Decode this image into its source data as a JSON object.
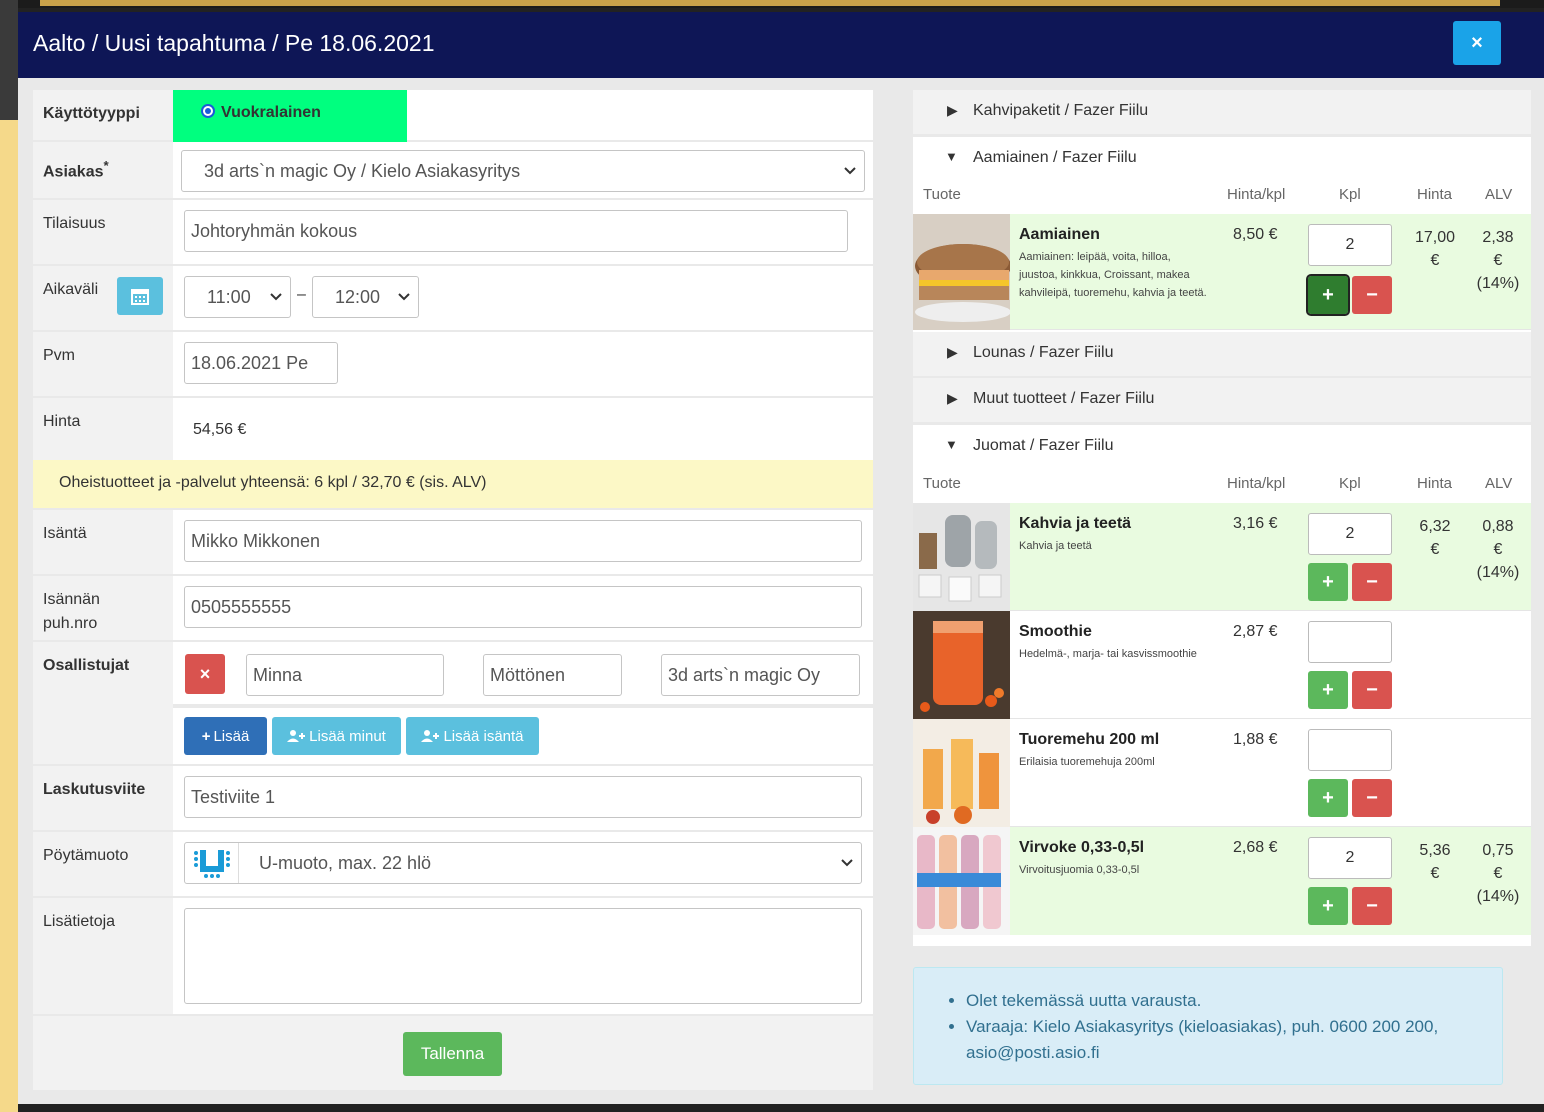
{
  "header": {
    "title": "Aalto / Uusi tapahtuma / Pe 18.06.2021",
    "close_label": "×"
  },
  "form": {
    "usage_type": {
      "label": "Käyttötyyppi",
      "option": "Vuokralainen"
    },
    "customer": {
      "label": "Asiakas",
      "required_mark": "*",
      "value": "3d arts`n magic Oy / Kielo Asiakasyritys"
    },
    "occasion": {
      "label": "Tilaisuus",
      "value": "Johtoryhmän kokous"
    },
    "time_range": {
      "label": "Aikaväli",
      "start": "11:00",
      "separator": "–",
      "end": "12:00"
    },
    "date": {
      "label": "Pvm",
      "value": "18.06.2021 Pe"
    },
    "price": {
      "label": "Hinta",
      "value": "54,56 €"
    },
    "extras_summary": "Oheistuotteet ja -palvelut yhteensä: 6 kpl / 32,70 € (sis. ALV)",
    "host": {
      "label": "Isäntä",
      "value": "Mikko Mikkonen"
    },
    "host_phone": {
      "label_line1": "Isännän",
      "label_line2": "puh.nro",
      "value": "0505555555"
    },
    "participants": {
      "label": "Osallistujat",
      "remove_label": "×",
      "first_name": "Minna",
      "last_name": "Möttönen",
      "company": "3d arts`n magic Oy",
      "add_label": "Lisää",
      "add_me_label": "Lisää minut",
      "add_host_label": "Lisää isäntä"
    },
    "billing_ref": {
      "label": "Laskutusviite",
      "value": "Testiviite 1"
    },
    "table_layout": {
      "label": "Pöytämuoto",
      "value": "U-muoto, max. 22 hlö"
    },
    "notes": {
      "label": "Lisätietoja",
      "value": ""
    },
    "save_label": "Tallenna"
  },
  "catalog": {
    "headers": {
      "product": "Tuote",
      "unit_price": "Hinta/kpl",
      "qty": "Kpl",
      "price": "Hinta",
      "vat": "ALV"
    },
    "categories": [
      {
        "label": "Kahvipaketit / Fazer Fiilu"
      },
      {
        "label": "Aamiainen / Fazer Fiilu"
      },
      {
        "label": "Lounas / Fazer Fiilu"
      },
      {
        "label": "Muut tuotteet / Fazer Fiilu"
      },
      {
        "label": "Juomat / Fazer Fiilu"
      }
    ],
    "breakfast": [
      {
        "name": "Aamiainen",
        "desc": "Aamiainen: leipää, voita, hilloa, juustoa, kinkkua, Croissant, makea kahvileipä, tuoremehu, kahvia ja teetä.",
        "unit_price": "8,50 €",
        "qty": "2",
        "total_1": "17,00",
        "total_2": "€",
        "vat_1": "2,38",
        "vat_2": "€",
        "vat_3": "(14%)"
      }
    ],
    "drinks": [
      {
        "name": "Kahvia ja teetä",
        "desc": "Kahvia ja teetä",
        "unit_price": "3,16 €",
        "qty": "2",
        "total_1": "6,32",
        "total_2": "€",
        "vat_1": "0,88",
        "vat_2": "€",
        "vat_3": "(14%)"
      },
      {
        "name": "Smoothie",
        "desc": "Hedelmä-, marja- tai kasvissmoothie",
        "unit_price": "2,87 €",
        "qty": ""
      },
      {
        "name": "Tuoremehu 200 ml",
        "desc": "Erilaisia tuoremehuja 200ml",
        "unit_price": "1,88 €",
        "qty": ""
      },
      {
        "name": "Virvoke 0,33-0,5l",
        "desc": "Virvoitusjuomia 0,33-0,5l",
        "unit_price": "2,68 €",
        "qty": "2",
        "total_1": "5,36",
        "total_2": "€",
        "vat_1": "0,75",
        "vat_2": "€",
        "vat_3": "(14%)"
      }
    ],
    "plus_label": "+",
    "minus_label": "−"
  },
  "info": {
    "line1": "Olet tekemässä uutta varausta.",
    "line2": "Varaaja: Kielo Asiakasyritys (kieloasiakas), puh. 0600 200 200, asio@posti.asio.fi"
  },
  "colors": {
    "header_bg": "#0e1656",
    "close_btn": "#1aa3e8",
    "radio_bg": "#00ff7f",
    "active_row": "#e9fbe0",
    "save_btn": "#5cb85c"
  }
}
